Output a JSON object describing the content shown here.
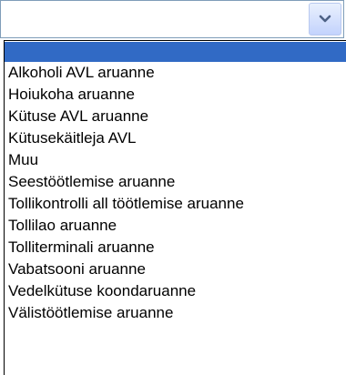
{
  "select": {
    "value": "",
    "options": [
      "",
      "Alkoholi AVL aruanne",
      "Hoiukoha aruanne",
      "Kütuse AVL aruanne",
      "Kütusekäitleja AVL",
      "Muu",
      "Seestöötlemise aruanne",
      "Tollikontrolli all töötlemise aruanne",
      "Tollilao aruanne",
      "Tolliterminali aruanne",
      "Vabatsooni aruanne",
      "Vedelkütuse koondaruanne",
      "Välistöötlemise aruanne"
    ],
    "selected_index": 0,
    "dropdown_icon": "chevron-down-icon"
  },
  "colors": {
    "highlight": "#316ac5",
    "border": "#7f9db9"
  }
}
